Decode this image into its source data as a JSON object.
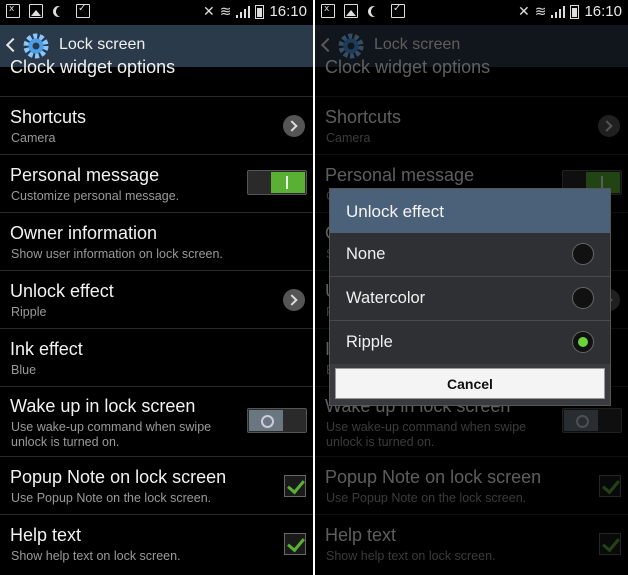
{
  "status_bar": {
    "time": "16:10",
    "icons": [
      "notification-icon",
      "image-icon",
      "moon-icon",
      "check-icon",
      "mute-icon",
      "wifi-icon",
      "signal-icon",
      "battery-icon"
    ]
  },
  "action_bar": {
    "title": "Lock screen",
    "icon": "gear-icon"
  },
  "settings_list": {
    "partial_top": "Clock widget options",
    "items": [
      {
        "title": "Shortcuts",
        "subtitle": "Camera",
        "control": "chevron"
      },
      {
        "title": "Personal message",
        "subtitle": "Customize personal message.",
        "control": "toggle-on"
      },
      {
        "title": "Owner information",
        "subtitle": "Show user information on lock screen.",
        "control": "none"
      },
      {
        "title": "Unlock effect",
        "subtitle": "Ripple",
        "control": "chevron"
      },
      {
        "title": "Ink effect",
        "subtitle": "Blue",
        "control": "none"
      },
      {
        "title": "Wake up in lock screen",
        "subtitle_line1": "Use wake-up command when swipe",
        "subtitle_line2": "unlock is turned on.",
        "control": "toggle-off"
      },
      {
        "title": "Popup Note on lock screen",
        "subtitle": "Use Popup Note on the lock screen.",
        "control": "checkbox-checked"
      },
      {
        "title": "Help text",
        "subtitle": "Show help text on lock screen.",
        "control": "checkbox-checked"
      }
    ]
  },
  "dialog": {
    "title": "Unlock effect",
    "options": [
      {
        "label": "None",
        "selected": false
      },
      {
        "label": "Watercolor",
        "selected": false
      },
      {
        "label": "Ripple",
        "selected": true
      }
    ],
    "cancel_label": "Cancel"
  },
  "colors": {
    "action_bar_bg": "#2b3a4a",
    "dialog_header_bg": "#4a6179",
    "accent_green": "#5ab034"
  }
}
